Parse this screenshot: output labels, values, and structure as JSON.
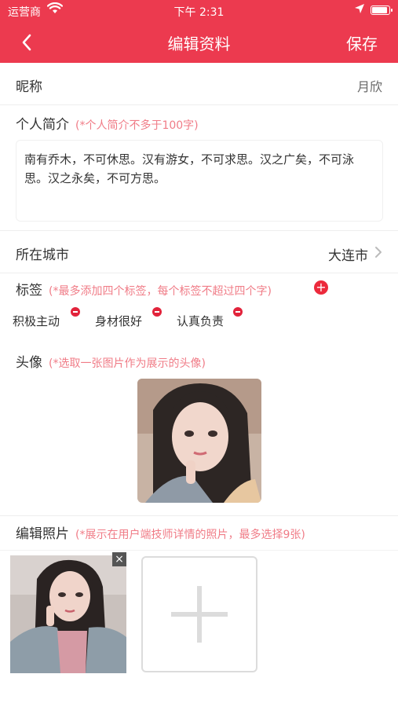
{
  "status_bar": {
    "carrier": "运营商",
    "time": "下午 2:31"
  },
  "nav": {
    "title": "编辑资料",
    "save_label": "保存"
  },
  "nickname": {
    "label": "昵称",
    "value": "月欣"
  },
  "intro": {
    "label": "个人简介",
    "hint": "(*个人简介不多于100字)",
    "text": "南有乔木，不可休思。汉有游女，不可求思。汉之广矣，不可泳思。汉之永矣，不可方思。"
  },
  "city": {
    "label": "所在城市",
    "value": "大连市"
  },
  "tags": {
    "label": "标签",
    "hint": "(*最多添加四个标签，每个标签不超过四个字)",
    "items": [
      "积极主动",
      "身材很好",
      "认真负责"
    ]
  },
  "avatar": {
    "label": "头像",
    "hint": "(*选取一张图片作为展示的头像)"
  },
  "photos": {
    "label": "编辑照片",
    "hint": "(*展示在用户端技师详情的照片，最多选择9张)"
  },
  "colors": {
    "accent": "#ec3a4f",
    "hint": "#f07c87",
    "badge": "#e2233b"
  }
}
